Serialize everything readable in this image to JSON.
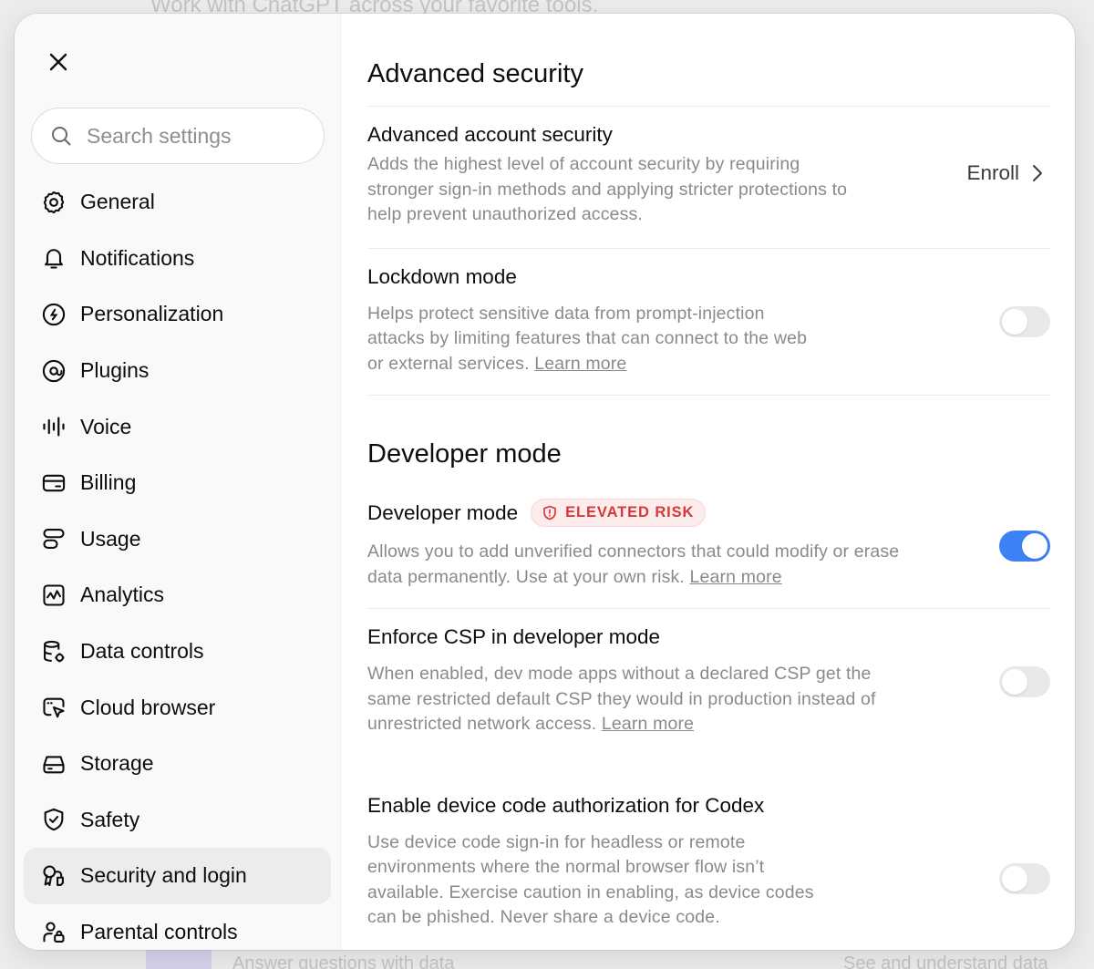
{
  "background": {
    "top_text": "Work with ChatGPT across your favorite tools.",
    "bottom_left_text": "Answer questions with data",
    "bottom_right_text": "See and understand data"
  },
  "sidebar": {
    "close_icon": "close-icon",
    "search_placeholder": "Search settings",
    "items": [
      {
        "label": "General",
        "icon": "gear-icon"
      },
      {
        "label": "Notifications",
        "icon": "bell-icon"
      },
      {
        "label": "Personalization",
        "icon": "personalization-icon"
      },
      {
        "label": "Plugins",
        "icon": "plugins-icon"
      },
      {
        "label": "Voice",
        "icon": "voice-waveform-icon"
      },
      {
        "label": "Billing",
        "icon": "card-icon"
      },
      {
        "label": "Usage",
        "icon": "usage-icon"
      },
      {
        "label": "Analytics",
        "icon": "analytics-chart-icon"
      },
      {
        "label": "Data controls",
        "icon": "database-gear-icon"
      },
      {
        "label": "Cloud browser",
        "icon": "browser-cursor-icon"
      },
      {
        "label": "Storage",
        "icon": "storage-drive-icon"
      },
      {
        "label": "Safety",
        "icon": "shield-check-icon"
      },
      {
        "label": "Security and login",
        "icon": "key-lock-icon"
      },
      {
        "label": "Parental controls",
        "icon": "parental-icon"
      }
    ],
    "active_item": "Security and login"
  },
  "advanced_security": {
    "title": "Advanced security",
    "account_security": {
      "title": "Advanced account security",
      "description": "Adds the highest level of account security by requiring stronger sign-in methods and applying stricter protections to help prevent unauthorized access.",
      "action_label": "Enroll"
    },
    "lockdown": {
      "title": "Lockdown mode",
      "description": "Helps protect sensitive data from prompt-injection attacks by limiting features that can connect to the web or external services. ",
      "link": "Learn more",
      "enabled": false
    }
  },
  "developer_mode": {
    "title": "Developer mode",
    "dev_mode": {
      "title": "Developer mode",
      "badge": "ELEVATED RISK",
      "description": "Allows you to add unverified connectors that could modify or erase data permanently. Use at your own risk. ",
      "link": "Learn more",
      "enabled": true
    },
    "csp": {
      "title": "Enforce CSP in developer mode",
      "description": "When enabled, dev mode apps without a declared CSP get the same restricted default CSP they would in production instead of unrestricted network access. ",
      "link": "Learn more",
      "enabled": false
    },
    "device_code": {
      "title": "Enable device code authorization for Codex",
      "description": "Use device code sign-in for headless or remote environments where the normal browser flow isn’t available. Exercise caution in enabling, as device codes can be phished. Never share a device code.",
      "enabled": false
    }
  },
  "colors": {
    "toggle_on": "#3c82f6",
    "toggle_off": "#e9e9e9",
    "badge_text": "#d53a3a",
    "badge_bg": "#fdecec",
    "active_nav_bg": "#ececec"
  }
}
